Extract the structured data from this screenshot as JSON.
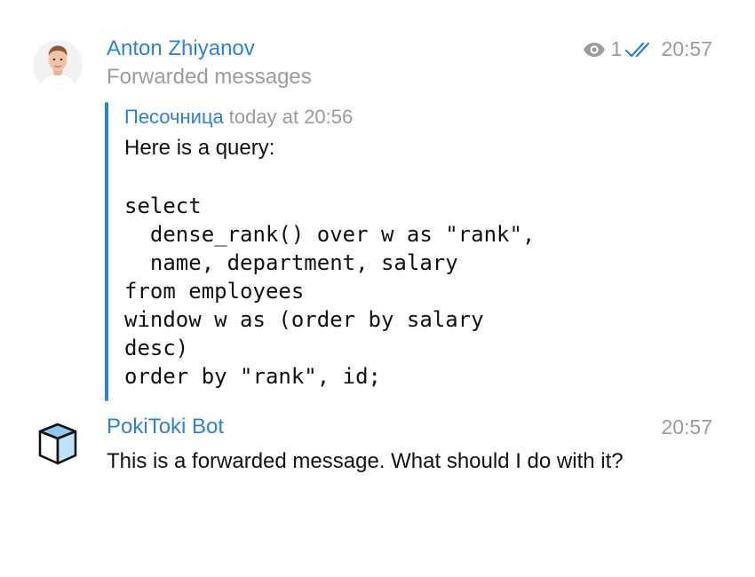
{
  "messages": [
    {
      "sender": "Anton Zhiyanov",
      "subtitle": "Forwarded messages",
      "views": "1",
      "time": "20:57",
      "forwarded": {
        "from": "Песочница",
        "date": "today at 20:56",
        "intro": "Here is a query:",
        "code": "select\n  dense_rank() over w as \"rank\",\n  name, department, salary\nfrom employees\nwindow w as (order by salary\ndesc)\norder by \"rank\", id;"
      }
    },
    {
      "sender": "PokiToki Bot",
      "time": "20:57",
      "text": "This is a forwarded message. What should I do with it?"
    }
  ],
  "icons": {
    "views": "eye-icon",
    "status": "double-check-icon",
    "bot_avatar": "cube-icon"
  },
  "colors": {
    "accent": "#2b84d0",
    "muted": "#9b9b9b",
    "text": "#111111"
  }
}
